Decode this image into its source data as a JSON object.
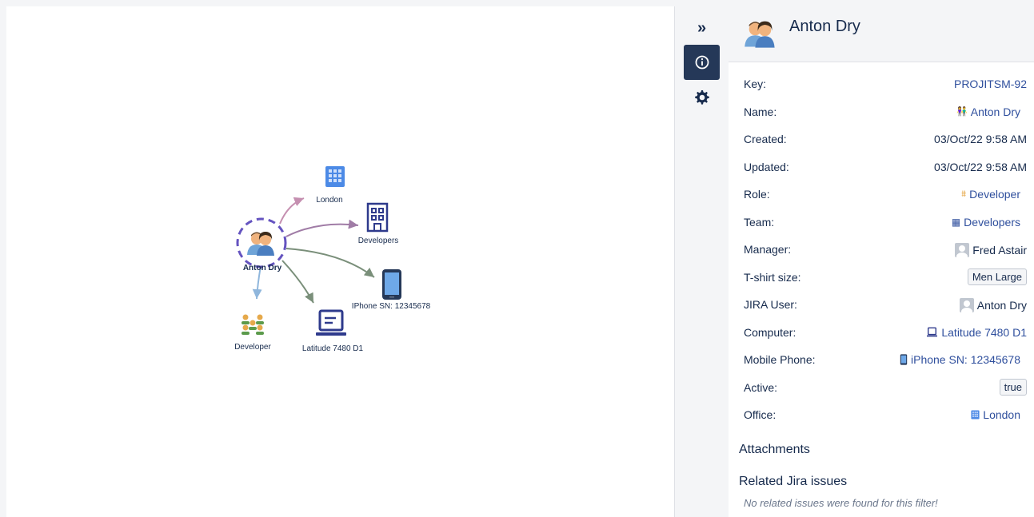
{
  "graph": {
    "center_label": "Anton Dry",
    "nodes": {
      "london": "London",
      "developers": "Developers",
      "iphone": "IPhone SN: 12345678",
      "latitude": "Latitude 7480 D1",
      "developer": "Developer"
    }
  },
  "toolbar": {
    "collapse_icon": "double-chevron-right-icon",
    "info_icon": "info-icon",
    "settings_icon": "gear-icon"
  },
  "panel": {
    "title": "Anton Dry",
    "fields": [
      {
        "label": "Key:",
        "value": "PROJITSM-92"
      },
      {
        "label": "Name:",
        "value": "Anton Dry"
      },
      {
        "label": "Created:",
        "value": "03/Oct/22 9:58 AM"
      },
      {
        "label": "Updated:",
        "value": "03/Oct/22 9:58 AM"
      },
      {
        "label": "Role:",
        "value": "Developer"
      },
      {
        "label": "Team:",
        "value": "Developers"
      },
      {
        "label": "Manager:",
        "value": "Fred Astair"
      },
      {
        "label": "T-shirt size:",
        "value": "Men Large"
      },
      {
        "label": "JIRA User:",
        "value": "Anton Dry"
      },
      {
        "label": "Computer:",
        "value": "Latitude 7480 D1"
      },
      {
        "label": "Mobile Phone:",
        "value": "iPhone SN: 12345678"
      },
      {
        "label": "Active:",
        "value": "true"
      },
      {
        "label": "Office:",
        "value": "London"
      }
    ],
    "attachments_title": "Attachments",
    "related_title": "Related Jira issues",
    "related_empty": "No related issues were found for this filter!"
  },
  "colors": {
    "link": "#2f4f9d",
    "active_button": "#253858",
    "center_ring": "#6554c0"
  }
}
